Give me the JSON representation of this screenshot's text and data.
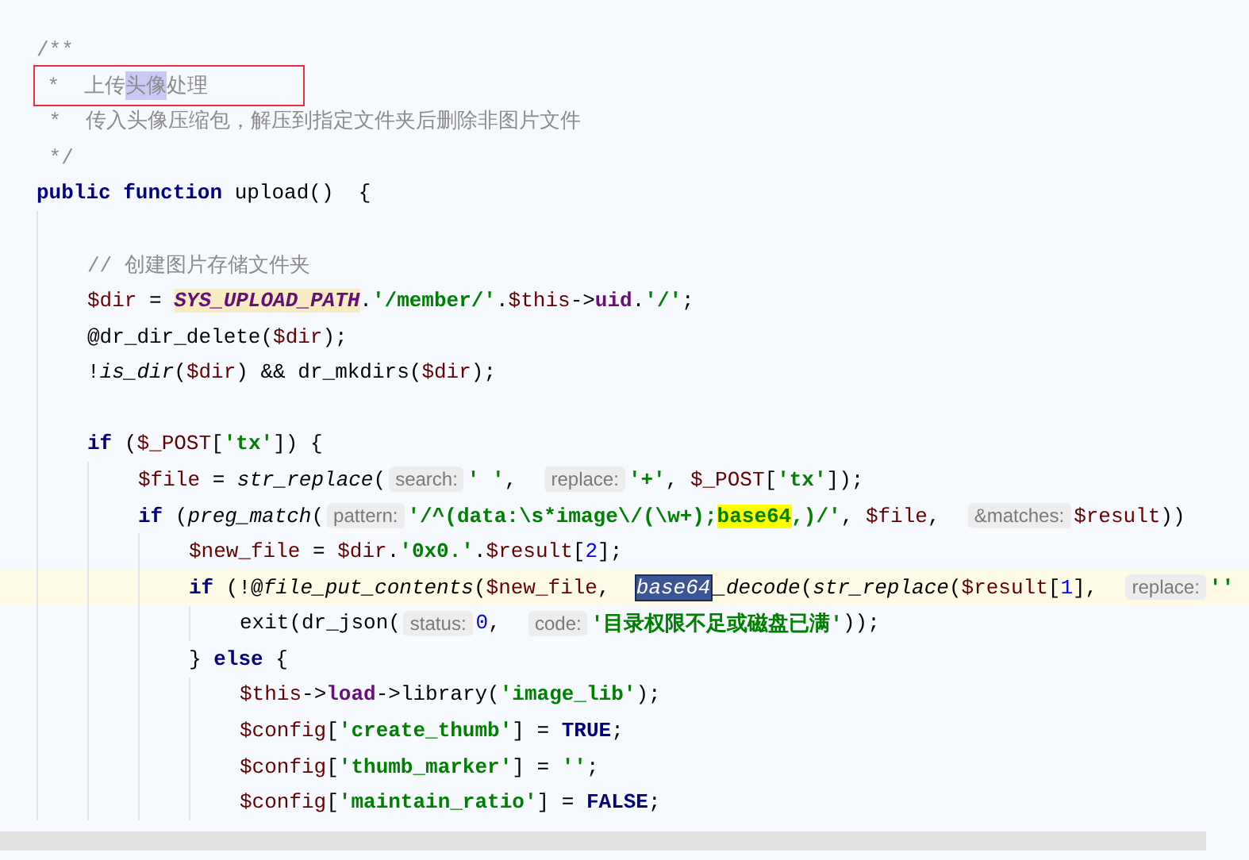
{
  "lines": [
    {
      "kind": "code",
      "current": false,
      "annotated": false,
      "tokens": [
        {
          "kind": "doc",
          "text": "/**"
        }
      ]
    },
    {
      "kind": "code",
      "current": false,
      "annotated": true,
      "tokens": [
        {
          "kind": "doc",
          "text": " *  上传"
        },
        {
          "kind": "selection",
          "text": "头像"
        },
        {
          "kind": "doc",
          "text": "处理"
        }
      ]
    },
    {
      "kind": "code",
      "current": false,
      "annotated": false,
      "tokens": [
        {
          "kind": "doc",
          "text": " *  传入头像压缩包，解压到指定文件夹后删除非图片文件"
        }
      ]
    },
    {
      "kind": "code",
      "current": false,
      "annotated": false,
      "tokens": [
        {
          "kind": "doc",
          "text": " */"
        }
      ]
    },
    {
      "kind": "code",
      "current": false,
      "annotated": false,
      "tokens": [
        {
          "kind": "keyword",
          "text": "public function"
        },
        {
          "kind": "plain",
          "text": " upload()  {"
        }
      ],
      "children": [
        {
          "kind": "blank"
        },
        {
          "kind": "code",
          "current": false,
          "annotated": false,
          "tokens": [
            {
              "kind": "comment",
              "text": "// 创建图片存储文件夹"
            }
          ]
        },
        {
          "kind": "code",
          "current": false,
          "annotated": false,
          "tokens": [
            {
              "kind": "variable",
              "text": "$dir"
            },
            {
              "kind": "plain",
              "text": " = "
            },
            {
              "kind": "constant",
              "text": "SYS_UPLOAD_PATH"
            },
            {
              "kind": "plain",
              "text": "."
            },
            {
              "kind": "string",
              "text": "'/member/'"
            },
            {
              "kind": "plain",
              "text": "."
            },
            {
              "kind": "variable",
              "text": "$this"
            },
            {
              "kind": "plain",
              "text": "->"
            },
            {
              "kind": "property",
              "text": "uid"
            },
            {
              "kind": "plain",
              "text": "."
            },
            {
              "kind": "string",
              "text": "'/'"
            },
            {
              "kind": "plain",
              "text": ";"
            }
          ]
        },
        {
          "kind": "code",
          "current": false,
          "annotated": false,
          "tokens": [
            {
              "kind": "plain",
              "text": "@dr_dir_delete("
            },
            {
              "kind": "variable",
              "text": "$dir"
            },
            {
              "kind": "plain",
              "text": ");"
            }
          ]
        },
        {
          "kind": "code",
          "current": false,
          "annotated": false,
          "tokens": [
            {
              "kind": "plain",
              "text": "!"
            },
            {
              "kind": "function",
              "text": "is_dir"
            },
            {
              "kind": "plain",
              "text": "("
            },
            {
              "kind": "variable",
              "text": "$dir"
            },
            {
              "kind": "plain",
              "text": ") && dr_mkdirs("
            },
            {
              "kind": "variable",
              "text": "$dir"
            },
            {
              "kind": "plain",
              "text": ");"
            }
          ]
        },
        {
          "kind": "blank"
        },
        {
          "kind": "code",
          "current": false,
          "annotated": false,
          "tokens": [
            {
              "kind": "keyword",
              "text": "if"
            },
            {
              "kind": "plain",
              "text": " ("
            },
            {
              "kind": "variable",
              "text": "$_POST"
            },
            {
              "kind": "plain",
              "text": "["
            },
            {
              "kind": "string",
              "text": "'tx'"
            },
            {
              "kind": "plain",
              "text": "]) {"
            }
          ],
          "children": [
            {
              "kind": "code",
              "current": false,
              "annotated": false,
              "tokens": [
                {
                  "kind": "variable",
                  "text": "$file"
                },
                {
                  "kind": "plain",
                  "text": " = "
                },
                {
                  "kind": "function",
                  "text": "str_replace"
                },
                {
                  "kind": "plain",
                  "text": "("
                },
                {
                  "kind": "hint",
                  "text": "search:"
                },
                {
                  "kind": "string",
                  "text": "' '"
                },
                {
                  "kind": "plain",
                  "text": ",  "
                },
                {
                  "kind": "hint",
                  "text": "replace:"
                },
                {
                  "kind": "string",
                  "text": "'+'"
                },
                {
                  "kind": "plain",
                  "text": ", "
                },
                {
                  "kind": "variable",
                  "text": "$_POST"
                },
                {
                  "kind": "plain",
                  "text": "["
                },
                {
                  "kind": "string",
                  "text": "'tx'"
                },
                {
                  "kind": "plain",
                  "text": "]);"
                }
              ]
            },
            {
              "kind": "code",
              "current": false,
              "annotated": false,
              "tokens": [
                {
                  "kind": "keyword",
                  "text": "if"
                },
                {
                  "kind": "plain",
                  "text": " ("
                },
                {
                  "kind": "function",
                  "text": "preg_match"
                },
                {
                  "kind": "plain",
                  "text": "("
                },
                {
                  "kind": "hint",
                  "text": "pattern:"
                },
                {
                  "kind": "string",
                  "text": "'/^(data:\\s*image\\/(\\w+);"
                },
                {
                  "kind": "match",
                  "text": "base64"
                },
                {
                  "kind": "string",
                  "text": ",)/'"
                },
                {
                  "kind": "plain",
                  "text": ", "
                },
                {
                  "kind": "variable",
                  "text": "$file"
                },
                {
                  "kind": "plain",
                  "text": ",  "
                },
                {
                  "kind": "hint",
                  "text": "&matches:"
                },
                {
                  "kind": "variable",
                  "text": "$result"
                },
                {
                  "kind": "plain",
                  "text": "))"
                }
              ],
              "children": [
                {
                  "kind": "code",
                  "current": false,
                  "annotated": false,
                  "tokens": [
                    {
                      "kind": "variable",
                      "text": "$new_file"
                    },
                    {
                      "kind": "plain",
                      "text": " = "
                    },
                    {
                      "kind": "variable",
                      "text": "$dir"
                    },
                    {
                      "kind": "plain",
                      "text": "."
                    },
                    {
                      "kind": "string",
                      "text": "'0x0.'"
                    },
                    {
                      "kind": "plain",
                      "text": "."
                    },
                    {
                      "kind": "variable",
                      "text": "$result"
                    },
                    {
                      "kind": "plain",
                      "text": "["
                    },
                    {
                      "kind": "number",
                      "text": "2"
                    },
                    {
                      "kind": "plain",
                      "text": "];"
                    }
                  ]
                },
                {
                  "kind": "code",
                  "current": true,
                  "annotated": false,
                  "tokens": [
                    {
                      "kind": "keyword",
                      "text": "if"
                    },
                    {
                      "kind": "plain",
                      "text": " (!@"
                    },
                    {
                      "kind": "function",
                      "text": "file_put_contents"
                    },
                    {
                      "kind": "plain",
                      "text": "("
                    },
                    {
                      "kind": "variable",
                      "text": "$new_file"
                    },
                    {
                      "kind": "plain",
                      "text": ",  "
                    },
                    {
                      "kind": "word-selected",
                      "text": "base64"
                    },
                    {
                      "kind": "function",
                      "text": "_decode"
                    },
                    {
                      "kind": "plain",
                      "text": "("
                    },
                    {
                      "kind": "function",
                      "text": "str_replace"
                    },
                    {
                      "kind": "plain",
                      "text": "("
                    },
                    {
                      "kind": "variable",
                      "text": "$result"
                    },
                    {
                      "kind": "plain",
                      "text": "["
                    },
                    {
                      "kind": "number",
                      "text": "1"
                    },
                    {
                      "kind": "plain",
                      "text": "],  "
                    },
                    {
                      "kind": "hint",
                      "text": "replace:"
                    },
                    {
                      "kind": "string",
                      "text": "''"
                    }
                  ],
                  "children": [
                    {
                      "kind": "code",
                      "current": false,
                      "annotated": false,
                      "tokens": [
                        {
                          "kind": "plain",
                          "text": "exit(dr_json("
                        },
                        {
                          "kind": "hint",
                          "text": "status:"
                        },
                        {
                          "kind": "number",
                          "text": "0"
                        },
                        {
                          "kind": "plain",
                          "text": ",  "
                        },
                        {
                          "kind": "hint",
                          "text": "code:"
                        },
                        {
                          "kind": "string",
                          "text": "'目录权限不足或磁盘已满'"
                        },
                        {
                          "kind": "plain",
                          "text": "));"
                        }
                      ]
                    }
                  ]
                },
                {
                  "kind": "code",
                  "current": false,
                  "annotated": false,
                  "tokens": [
                    {
                      "kind": "plain",
                      "text": "} "
                    },
                    {
                      "kind": "keyword",
                      "text": "else"
                    },
                    {
                      "kind": "plain",
                      "text": " {"
                    }
                  ],
                  "children": [
                    {
                      "kind": "code",
                      "current": false,
                      "annotated": false,
                      "tokens": [
                        {
                          "kind": "variable",
                          "text": "$this"
                        },
                        {
                          "kind": "plain",
                          "text": "->"
                        },
                        {
                          "kind": "property",
                          "text": "load"
                        },
                        {
                          "kind": "plain",
                          "text": "->library("
                        },
                        {
                          "kind": "string",
                          "text": "'image_lib'"
                        },
                        {
                          "kind": "plain",
                          "text": ");"
                        }
                      ]
                    },
                    {
                      "kind": "code",
                      "current": false,
                      "annotated": false,
                      "tokens": [
                        {
                          "kind": "variable",
                          "text": "$config"
                        },
                        {
                          "kind": "plain",
                          "text": "["
                        },
                        {
                          "kind": "string",
                          "text": "'create_thumb'"
                        },
                        {
                          "kind": "plain",
                          "text": "] = "
                        },
                        {
                          "kind": "keyword",
                          "text": "TRUE"
                        },
                        {
                          "kind": "plain",
                          "text": ";"
                        }
                      ]
                    },
                    {
                      "kind": "code",
                      "current": false,
                      "annotated": false,
                      "tokens": [
                        {
                          "kind": "variable",
                          "text": "$config"
                        },
                        {
                          "kind": "plain",
                          "text": "["
                        },
                        {
                          "kind": "string",
                          "text": "'thumb_marker'"
                        },
                        {
                          "kind": "plain",
                          "text": "] = "
                        },
                        {
                          "kind": "string",
                          "text": "''"
                        },
                        {
                          "kind": "plain",
                          "text": ";"
                        }
                      ]
                    },
                    {
                      "kind": "code",
                      "current": false,
                      "annotated": false,
                      "tokens": [
                        {
                          "kind": "variable",
                          "text": "$config"
                        },
                        {
                          "kind": "plain",
                          "text": "["
                        },
                        {
                          "kind": "string",
                          "text": "'maintain_ratio'"
                        },
                        {
                          "kind": "plain",
                          "text": "] = "
                        },
                        {
                          "kind": "keyword",
                          "text": "FALSE"
                        },
                        {
                          "kind": "plain",
                          "text": ";"
                        }
                      ]
                    }
                  ]
                }
              ]
            }
          ]
        }
      ]
    }
  ]
}
